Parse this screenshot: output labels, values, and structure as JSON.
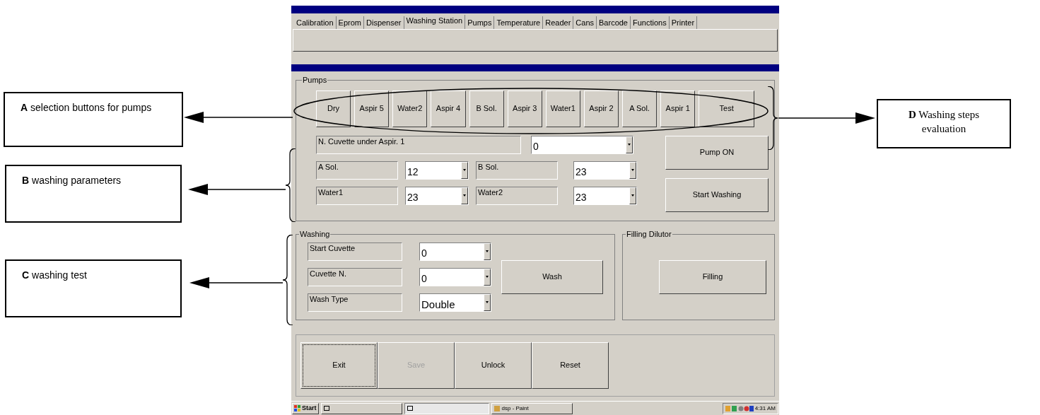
{
  "tabs": [
    {
      "label": "Calibration",
      "selected": false
    },
    {
      "label": "Eprom",
      "selected": false
    },
    {
      "label": "Dispenser",
      "selected": false
    },
    {
      "label": "Washing Station",
      "selected": true
    },
    {
      "label": "Pumps",
      "selected": false
    },
    {
      "label": "Temperature",
      "selected": false
    },
    {
      "label": "Reader",
      "selected": false
    },
    {
      "label": "Cans",
      "selected": false
    },
    {
      "label": "Barcode",
      "selected": false
    },
    {
      "label": "Functions",
      "selected": false
    },
    {
      "label": "Printer",
      "selected": false
    }
  ],
  "pumps": {
    "title": "Pumps",
    "buttons": [
      "Dry",
      "Aspir 5",
      "Water2",
      "Aspir 4",
      "B Sol.",
      "Aspir 3",
      "Water1",
      "Aspir 2",
      "A Sol.",
      "Aspir 1"
    ],
    "test_button": "Test"
  },
  "parameters": {
    "cuvette_label": "N. Cuvette under Aspir. 1",
    "cuvette_value": "0",
    "fields": [
      {
        "label": "A Sol.",
        "value": "12"
      },
      {
        "label": "B Sol.",
        "value": "23"
      },
      {
        "label": "Water1",
        "value": "23"
      },
      {
        "label": "Water2",
        "value": "23"
      }
    ],
    "buttons": [
      "Pump ON",
      "Start Washing"
    ]
  },
  "washing": {
    "title": "Washing",
    "fields": [
      {
        "label": "Start Cuvette",
        "value": "0"
      },
      {
        "label": "Cuvette N.",
        "value": "0"
      },
      {
        "label": "Wash Type",
        "value": "Double"
      }
    ],
    "button": "Wash"
  },
  "filling": {
    "title": "Filling Dilutor",
    "button": "Filling"
  },
  "footer_buttons": [
    {
      "label": "Exit",
      "disabled": false
    },
    {
      "label": "Save",
      "disabled": true
    },
    {
      "label": "Unlock",
      "disabled": false
    },
    {
      "label": "Reset",
      "disabled": false
    }
  ],
  "taskbar": {
    "start": "Start",
    "task": "dsp - Paint",
    "clock": "4:31 AM"
  },
  "annotations": [
    {
      "text": "**A**  selection buttons for pumps"
    },
    {
      "text": "**B**  washing parameters"
    },
    {
      "text": "**C**  washing test"
    },
    {
      "text": "**D** Washing steps evaluation"
    }
  ]
}
